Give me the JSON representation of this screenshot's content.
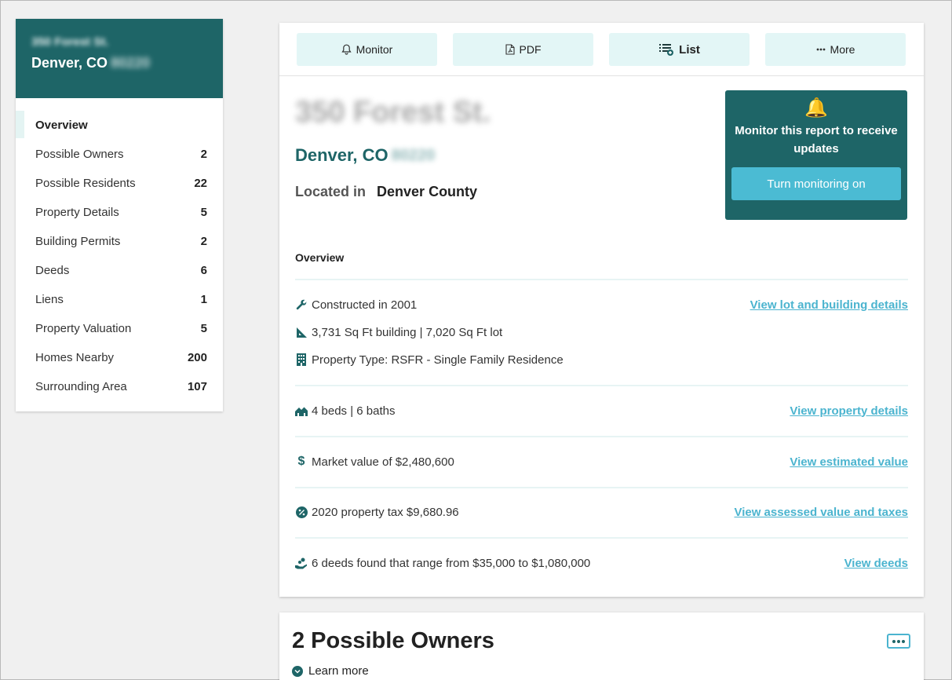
{
  "sidebar": {
    "street": "350 Forest St.",
    "city": "Denver, CO",
    "zip": "80220",
    "items": [
      {
        "label": "Overview",
        "count": ""
      },
      {
        "label": "Possible Owners",
        "count": "2"
      },
      {
        "label": "Possible Residents",
        "count": "22"
      },
      {
        "label": "Property Details",
        "count": "5"
      },
      {
        "label": "Building Permits",
        "count": "2"
      },
      {
        "label": "Deeds",
        "count": "6"
      },
      {
        "label": "Liens",
        "count": "1"
      },
      {
        "label": "Property Valuation",
        "count": "5"
      },
      {
        "label": "Homes Nearby",
        "count": "200"
      },
      {
        "label": "Surrounding Area",
        "count": "107"
      }
    ]
  },
  "toolbar": {
    "monitor": "Monitor",
    "pdf": "PDF",
    "list": "List",
    "more": "More"
  },
  "header": {
    "street": "350 Forest St.",
    "city": "Denver, CO",
    "zip": "80220",
    "located_label": "Located in",
    "county": "Denver County"
  },
  "monitor_box": {
    "icon": "bell-icon",
    "text": "Monitor this report to receive updates",
    "button": "Turn monitoring on"
  },
  "overview": {
    "label": "Overview",
    "rows": [
      {
        "icon": "wrench-icon",
        "text": "Constructed in 2001",
        "link": "View lot and building details"
      },
      {
        "icon": "ruler-triangle-icon",
        "text": "3,731 Sq Ft building | 7,020 Sq Ft lot",
        "link": ""
      },
      {
        "icon": "building-icon",
        "text": "Property Type: RSFR - Single Family Residence",
        "link": ""
      },
      {
        "icon": "homes-icon",
        "text": "4 beds | 6 baths",
        "link": "View property details"
      },
      {
        "icon": "dollar-icon",
        "text": "Market value of $2,480,600",
        "link": "View estimated value"
      },
      {
        "icon": "percent-icon",
        "text": "2020 property tax $9,680.96",
        "link": "View assessed value and taxes"
      },
      {
        "icon": "hand-coins-icon",
        "text": "6 deeds found that range from $35,000 to $1,080,000",
        "link": "View deeds"
      }
    ]
  },
  "owners": {
    "title": "2 Possible Owners",
    "learn_more": "Learn more"
  },
  "colors": {
    "brand_teal": "#1e6567",
    "accent_blue": "#4bb4cf",
    "button_bg": "#e3f6f6"
  }
}
